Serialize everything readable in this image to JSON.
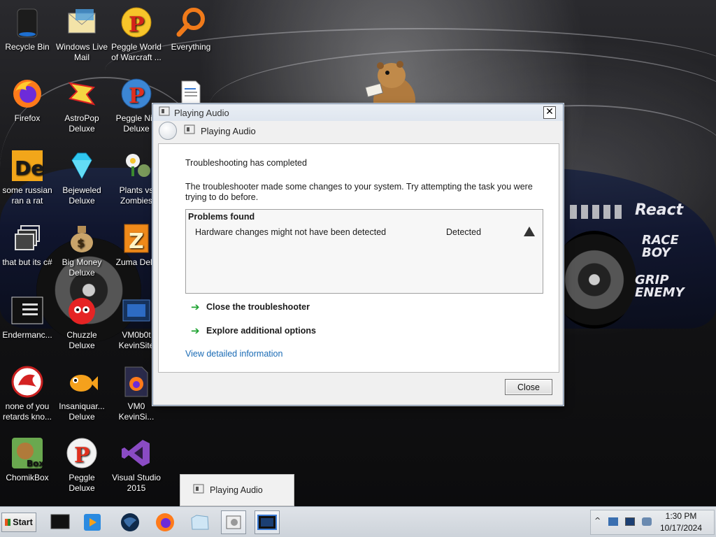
{
  "desktop": {
    "icons": [
      {
        "label": "Recycle Bin",
        "icon": "recycle-bin-icon"
      },
      {
        "label": "Windows Live Mail",
        "icon": "mail-icon"
      },
      {
        "label": "Peggle World of Warcraft ...",
        "icon": "peggle-icon"
      },
      {
        "label": "Everything",
        "icon": "search-icon"
      },
      {
        "label": "Firefox",
        "icon": "firefox-icon"
      },
      {
        "label": "AstroPop Deluxe",
        "icon": "astropop-icon"
      },
      {
        "label": "Peggle Nig Deluxe",
        "icon": "peggle-icon"
      },
      {
        "label": "some russian ran a rat",
        "icon": "de-icon"
      },
      {
        "label": "Bejeweled Deluxe",
        "icon": "gem-icon"
      },
      {
        "label": "Plants vs Zombies",
        "icon": "plant-icon"
      },
      {
        "label": "that but its c#",
        "icon": "windows-stack-icon"
      },
      {
        "label": "Big Money Deluxe",
        "icon": "money-bag-icon"
      },
      {
        "label": "Zuma Delu",
        "icon": "zuma-icon"
      },
      {
        "label": "Endermanc...",
        "icon": "terminal-icon"
      },
      {
        "label": "Chuzzle Deluxe",
        "icon": "chuzzle-icon"
      },
      {
        "label": "VM0b0t KevinSite",
        "icon": "vm-icon"
      },
      {
        "label": "none of you retards kno...",
        "icon": "dragon-icon"
      },
      {
        "label": "Insaniquar... Deluxe",
        "icon": "fish-icon"
      },
      {
        "label": "VM0 KevinSi...",
        "icon": "firefox-file-icon"
      },
      {
        "label": "ChomikBox",
        "icon": "chomikbox-icon"
      },
      {
        "label": "Peggle Deluxe",
        "icon": "peggle-icon"
      },
      {
        "label": "Visual Studio 2015",
        "icon": "visual-studio-icon"
      }
    ],
    "car_text": [
      "React",
      "RACE BOY",
      "GRIP ENEMY"
    ]
  },
  "dialog": {
    "window_title": "Playing Audio",
    "nav_title": "Playing Audio",
    "heading": "Troubleshooting has completed",
    "description": "The troubleshooter made some changes to your system. Try attempting the task you were trying to do before.",
    "problems": {
      "title": "Problems found",
      "rows": [
        {
          "issue": "Hardware changes might not have been detected",
          "status": "Detected"
        }
      ]
    },
    "tasks": [
      "Close the troubleshooter",
      "Explore additional options"
    ],
    "detail_link": "View detailed information",
    "close_button": "Close"
  },
  "taskbar": {
    "start_label": "Start",
    "preview_label": "Playing Audio",
    "time": "1:30 PM",
    "date": "10/17/2024"
  }
}
